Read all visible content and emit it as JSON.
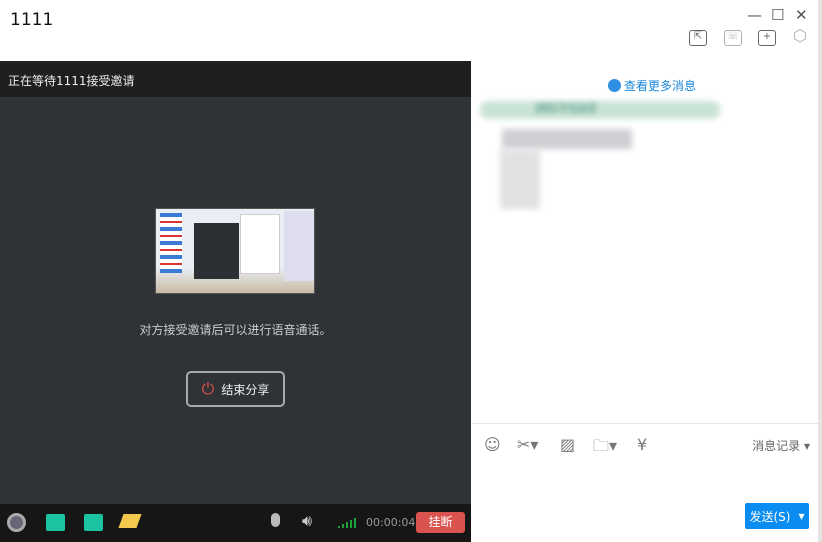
{
  "window": {
    "title": "1111",
    "minimize": "—",
    "maximize": "☐",
    "close": "✕"
  },
  "toolbar": {
    "share_screen_icon": "⇱",
    "call_icon": "☏",
    "add_icon": "+",
    "settings_icon": "⬡"
  },
  "call": {
    "status": "正在等待1111接受邀请",
    "message": "对方接受邀请后可以进行语音通话。",
    "end_share": "结束分享",
    "timer": "00:00:04",
    "hangup": "挂断"
  },
  "chat": {
    "more_messages": "查看更多消息",
    "date": "2017/12/2"
  },
  "input_toolbar": {
    "history": "消息记录 ▾"
  },
  "send": {
    "label": "发送(S)",
    "arrow": "▾"
  }
}
